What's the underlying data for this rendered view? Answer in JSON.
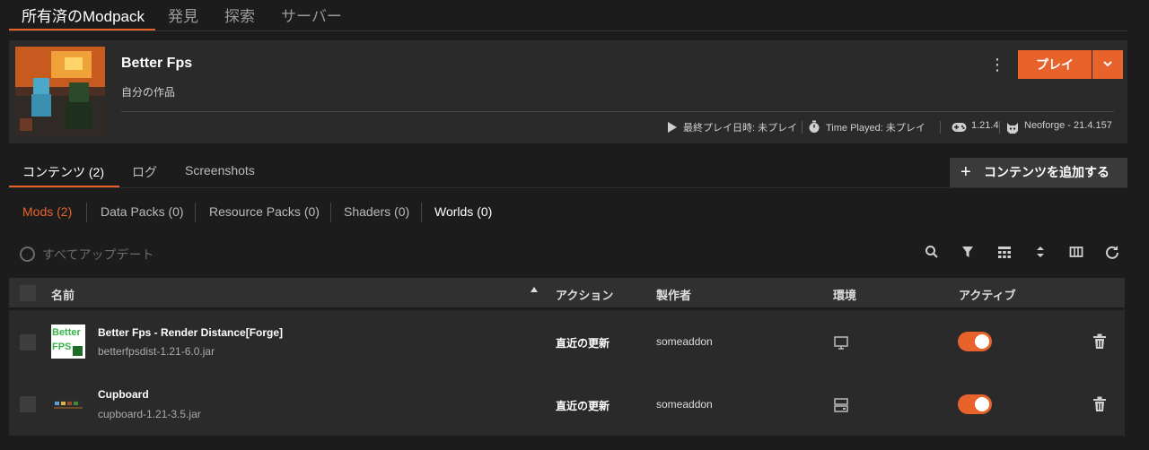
{
  "top_tabs": [
    {
      "label": "所有済のModpack"
    },
    {
      "label": "発見"
    },
    {
      "label": "探索"
    },
    {
      "label": "サーバー"
    }
  ],
  "pack": {
    "title": "Better Fps",
    "subtitle": "自分の作品",
    "play_label": "プレイ",
    "last_played": "最終プレイ日時: 未プレイ",
    "time_played": "Time Played: 未プレイ",
    "version": "1.21.4",
    "loader": "Neoforge - 21.4.157"
  },
  "content_tabs": [
    {
      "label": "コンテンツ (2)"
    },
    {
      "label": "ログ"
    },
    {
      "label": "Screenshots"
    }
  ],
  "add_content_label": "コンテンツを追加する",
  "filters": [
    {
      "label": "Mods (2)"
    },
    {
      "label": "Data Packs (0)"
    },
    {
      "label": "Resource Packs (0)"
    },
    {
      "label": "Shaders (0)"
    },
    {
      "label": "Worlds (0)"
    }
  ],
  "update_all_label": "すべてアップデート",
  "table": {
    "headers": {
      "name": "名前",
      "action": "アクション",
      "author": "製作者",
      "env": "環境",
      "active": "アクティブ"
    },
    "rows": [
      {
        "name": "Better Fps - Render Distance[Forge]",
        "file": "betterfpsdist-1.21-6.0.jar",
        "action": "直近の更新",
        "author": "someaddon",
        "env_icon": "monitor-icon",
        "active": true,
        "icon_text_1": "Better",
        "icon_text_2": "FPS"
      },
      {
        "name": "Cupboard",
        "file": "cupboard-1.21-3.5.jar",
        "action": "直近の更新",
        "author": "someaddon",
        "env_icon": "server-icon",
        "active": true
      }
    ]
  },
  "colors": {
    "accent": "#e8622c",
    "background": "#1c1c1c",
    "card": "#2a2a2a"
  }
}
